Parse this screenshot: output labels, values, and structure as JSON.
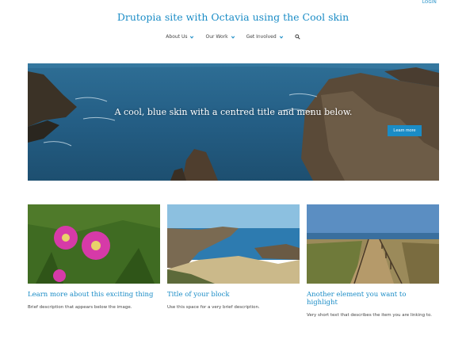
{
  "header": {
    "login": "LOGIN",
    "site_title": "Drutopia site with Octavia using the Cool skin"
  },
  "nav": {
    "items": [
      {
        "label": "About Us",
        "icon": "chevron-down-icon"
      },
      {
        "label": "Our Work",
        "icon": "chevron-down-icon"
      },
      {
        "label": "Get Involved",
        "icon": "chevron-down-icon"
      }
    ],
    "search_icon": "search-icon"
  },
  "hero": {
    "text": "A cool, blue skin with a centred title and menu below.",
    "button": "Learn more"
  },
  "cards": [
    {
      "title": "Learn more about this exciting thing",
      "description": "Brief description that appears below the image."
    },
    {
      "title": "Title of your block",
      "description": "Use this space for a very brief description."
    },
    {
      "title": "Another element you want to highlight",
      "description": "Very short text that describes the item you are linking to."
    }
  ],
  "colors": {
    "accent": "#1a8cc6",
    "text": "#333333"
  }
}
